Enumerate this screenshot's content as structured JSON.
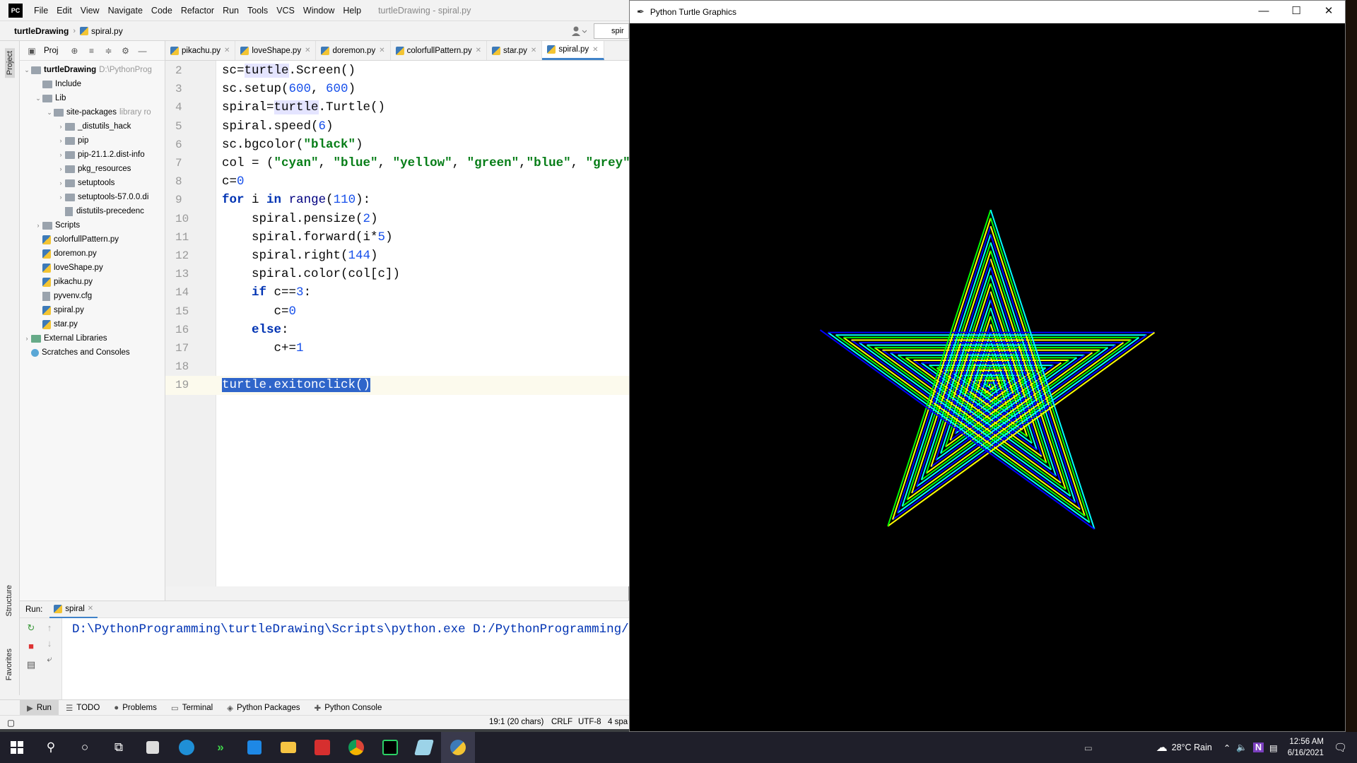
{
  "ide": {
    "logo": "PC",
    "menu": [
      "File",
      "Edit",
      "View",
      "Navigate",
      "Code",
      "Refactor",
      "Run",
      "Tools",
      "VCS",
      "Window",
      "Help"
    ],
    "window_title": "turtleDrawing - spiral.py",
    "breadcrumb_project": "turtleDrawing",
    "breadcrumb_file": "spiral.py",
    "run_config": "spir",
    "project_panel_label": "Proj",
    "left_strip": {
      "project": "Project",
      "structure": "Structure",
      "favorites": "Favorites"
    },
    "tree": [
      {
        "label": "turtleDrawing",
        "hint": "D:\\PythonProg",
        "indent": 0,
        "type": "folder",
        "arrow": "v",
        "bold": true
      },
      {
        "label": "Include",
        "indent": 1,
        "type": "folder",
        "arrow": ""
      },
      {
        "label": "Lib",
        "indent": 1,
        "type": "folder",
        "arrow": "v"
      },
      {
        "label": "site-packages",
        "hint": "library ro",
        "indent": 2,
        "type": "folder",
        "arrow": "v"
      },
      {
        "label": "_distutils_hack",
        "indent": 3,
        "type": "folder",
        "arrow": ">"
      },
      {
        "label": "pip",
        "indent": 3,
        "type": "folder",
        "arrow": ">"
      },
      {
        "label": "pip-21.1.2.dist-info",
        "indent": 3,
        "type": "folder",
        "arrow": ">"
      },
      {
        "label": "pkg_resources",
        "indent": 3,
        "type": "folder",
        "arrow": ">"
      },
      {
        "label": "setuptools",
        "indent": 3,
        "type": "folder",
        "arrow": ">"
      },
      {
        "label": "setuptools-57.0.0.di",
        "indent": 3,
        "type": "folder",
        "arrow": ">"
      },
      {
        "label": "distutils-precedenc",
        "indent": 3,
        "type": "cfg",
        "arrow": ""
      },
      {
        "label": "Scripts",
        "indent": 1,
        "type": "folder",
        "arrow": ">"
      },
      {
        "label": "colorfullPattern.py",
        "indent": 1,
        "type": "py",
        "arrow": ""
      },
      {
        "label": "doremon.py",
        "indent": 1,
        "type": "py",
        "arrow": ""
      },
      {
        "label": "loveShape.py",
        "indent": 1,
        "type": "py",
        "arrow": ""
      },
      {
        "label": "pikachu.py",
        "indent": 1,
        "type": "py",
        "arrow": ""
      },
      {
        "label": "pyvenv.cfg",
        "indent": 1,
        "type": "cfg",
        "arrow": ""
      },
      {
        "label": "spiral.py",
        "indent": 1,
        "type": "py",
        "arrow": ""
      },
      {
        "label": "star.py",
        "indent": 1,
        "type": "py",
        "arrow": ""
      },
      {
        "label": "External Libraries",
        "indent": 0,
        "type": "lib",
        "arrow": ">"
      },
      {
        "label": "Scratches and Consoles",
        "indent": 0,
        "type": "scratch",
        "arrow": ""
      }
    ],
    "tabs": [
      {
        "label": "pikachu.py",
        "active": false
      },
      {
        "label": "loveShape.py",
        "active": false
      },
      {
        "label": "doremon.py",
        "active": false
      },
      {
        "label": "colorfullPattern.py",
        "active": false
      },
      {
        "label": "star.py",
        "active": false
      },
      {
        "label": "spiral.py",
        "active": true
      }
    ],
    "code_lines": [
      {
        "n": "2",
        "tokens": [
          [
            "sc=",
            ""
          ],
          [
            "turtle",
            "hl"
          ],
          [
            ".Screen()",
            ""
          ]
        ]
      },
      {
        "n": "3",
        "tokens": [
          [
            "sc.setup(",
            ""
          ],
          [
            "600",
            "nu"
          ],
          [
            ", ",
            ""
          ],
          [
            "600",
            "nu"
          ],
          [
            ")",
            ""
          ]
        ]
      },
      {
        "n": "4",
        "tokens": [
          [
            "spiral=",
            ""
          ],
          [
            "turtle",
            "hl"
          ],
          [
            ".Turtle()",
            ""
          ]
        ]
      },
      {
        "n": "5",
        "tokens": [
          [
            "spiral.speed(",
            ""
          ],
          [
            "6",
            "nu"
          ],
          [
            ")",
            ""
          ]
        ]
      },
      {
        "n": "6",
        "tokens": [
          [
            "sc.bgcolor(",
            ""
          ],
          [
            "\"black\"",
            "st"
          ],
          [
            ")",
            ""
          ]
        ]
      },
      {
        "n": "7",
        "tokens": [
          [
            "col = (",
            ""
          ],
          [
            "\"cyan\"",
            "st"
          ],
          [
            ", ",
            ""
          ],
          [
            "\"blue\"",
            "st"
          ],
          [
            ", ",
            ""
          ],
          [
            "\"yellow\"",
            "st"
          ],
          [
            ", ",
            ""
          ],
          [
            "\"green\"",
            "st"
          ],
          [
            ",",
            ""
          ],
          [
            "\"blue\"",
            "st"
          ],
          [
            ", ",
            ""
          ],
          [
            "\"grey\"",
            "st"
          ],
          [
            ")",
            ""
          ]
        ]
      },
      {
        "n": "8",
        "tokens": [
          [
            "c=",
            ""
          ],
          [
            "0",
            "nu"
          ]
        ]
      },
      {
        "n": "9",
        "tokens": [
          [
            "for",
            "kw"
          ],
          [
            " i ",
            ""
          ],
          [
            "in",
            "kw"
          ],
          [
            " ",
            ""
          ],
          [
            "range",
            "bi"
          ],
          [
            "(",
            ""
          ],
          [
            "110",
            "nu"
          ],
          [
            "):",
            ""
          ]
        ]
      },
      {
        "n": "10",
        "tokens": [
          [
            "    spiral.pensize(",
            ""
          ],
          [
            "2",
            "nu"
          ],
          [
            ")",
            ""
          ]
        ]
      },
      {
        "n": "11",
        "tokens": [
          [
            "    spiral.forward(i*",
            ""
          ],
          [
            "5",
            "nu"
          ],
          [
            ")",
            ""
          ]
        ]
      },
      {
        "n": "12",
        "tokens": [
          [
            "    spiral.right(",
            ""
          ],
          [
            "144",
            "nu"
          ],
          [
            ")",
            ""
          ]
        ]
      },
      {
        "n": "13",
        "tokens": [
          [
            "    spiral.color(col[c])",
            ""
          ]
        ]
      },
      {
        "n": "14",
        "tokens": [
          [
            "    ",
            ""
          ],
          [
            "if",
            "kw"
          ],
          [
            " c==",
            ""
          ],
          [
            "3",
            "nu"
          ],
          [
            ":",
            ""
          ]
        ]
      },
      {
        "n": "15",
        "tokens": [
          [
            "       c=",
            ""
          ],
          [
            "0",
            "nu"
          ]
        ]
      },
      {
        "n": "16",
        "tokens": [
          [
            "    ",
            ""
          ],
          [
            "else",
            "kw"
          ],
          [
            ":",
            ""
          ]
        ]
      },
      {
        "n": "17",
        "tokens": [
          [
            "       c+=",
            ""
          ],
          [
            "1",
            "nu"
          ]
        ]
      },
      {
        "n": "18",
        "tokens": []
      },
      {
        "n": "19",
        "tokens": [
          [
            "turtle.exitonclick()",
            "sel"
          ]
        ],
        "current": true
      }
    ],
    "run": {
      "label": "Run:",
      "tab": "spiral",
      "console": "D:\\PythonProgramming\\turtleDrawing\\Scripts\\python.exe D:/PythonProgramming/turtl"
    },
    "tool_windows": [
      {
        "label": "Run",
        "on": true,
        "icon": "▶"
      },
      {
        "label": "TODO",
        "on": false,
        "icon": "☰"
      },
      {
        "label": "Problems",
        "on": false,
        "icon": "●"
      },
      {
        "label": "Terminal",
        "on": false,
        "icon": "▭"
      },
      {
        "label": "Python Packages",
        "on": false,
        "icon": "◈"
      },
      {
        "label": "Python Console",
        "on": false,
        "icon": "✚"
      }
    ],
    "status": {
      "position": "19:1 (20 chars)",
      "line_sep": "CRLF",
      "encoding": "UTF-8",
      "indent": "4 spa"
    }
  },
  "turtle_window": {
    "title": "Python Turtle Graphics",
    "controls": {
      "minimize": "—",
      "maximize": "☐",
      "close": "✕"
    },
    "drawing": {
      "background": "#000000",
      "colors": [
        "#00ffff",
        "#0000ff",
        "#ffff00",
        "#00ff00"
      ],
      "iterations": 110,
      "step": 5,
      "turn_degrees": 144
    }
  },
  "taskbar": {
    "weather": "28°C  Rain",
    "time": "12:56 AM",
    "date": "6/16/2021"
  }
}
